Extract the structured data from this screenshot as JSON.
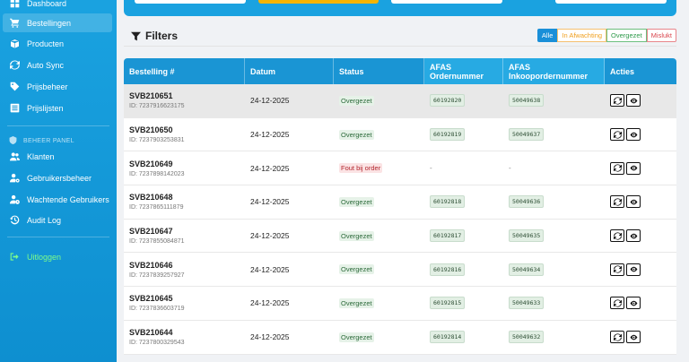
{
  "sidebar": {
    "items": [
      {
        "label": "Dashboard",
        "icon": "dashboard-icon"
      },
      {
        "label": "Bestellingen",
        "icon": "cart-icon",
        "active": true
      },
      {
        "label": "Producten",
        "icon": "box-icon"
      },
      {
        "label": "Auto Sync",
        "icon": "sync-icon"
      },
      {
        "label": "Prijsbeheer",
        "icon": "tag-icon"
      },
      {
        "label": "Prijslijsten",
        "icon": "list-icon"
      }
    ],
    "section_label": "BEHEER PANEL",
    "admin_items": [
      {
        "label": "Klanten",
        "icon": "users-icon"
      },
      {
        "label": "Gebruikersbeheer",
        "icon": "user-gear-icon"
      },
      {
        "label": "Wachtende Gebruikers",
        "icon": "user-clock-icon"
      },
      {
        "label": "Audit Log",
        "icon": "history-icon"
      }
    ],
    "logout_label": "Uitloggen"
  },
  "filters": {
    "title": "Filters",
    "buttons": [
      "Alle",
      "In Afwachting",
      "Overgezet",
      "Mislukt"
    ],
    "active": "Alle"
  },
  "table": {
    "headers": [
      "Bestelling #",
      "Datum",
      "Status",
      "AFAS Ordernummer",
      "AFAS Inkoopordernummer",
      "Acties"
    ],
    "rows": [
      {
        "order": "SVB210651",
        "id": "ID: 7237916623175",
        "date": "24-12-2025",
        "status": "Overgezet",
        "afas": "60192820",
        "inkoop": "50049638"
      },
      {
        "order": "SVB210650",
        "id": "ID: 7237903253831",
        "date": "24-12-2025",
        "status": "Overgezet",
        "afas": "60192819",
        "inkoop": "50049637"
      },
      {
        "order": "SVB210649",
        "id": "ID: 7237898142023",
        "date": "24-12-2025",
        "status": "Fout bij order",
        "afas": "-",
        "inkoop": "-"
      },
      {
        "order": "SVB210648",
        "id": "ID: 7237865111879",
        "date": "24-12-2025",
        "status": "Overgezet",
        "afas": "60192818",
        "inkoop": "50049636"
      },
      {
        "order": "SVB210647",
        "id": "ID: 7237855084871",
        "date": "24-12-2025",
        "status": "Overgezet",
        "afas": "60192817",
        "inkoop": "50049635"
      },
      {
        "order": "SVB210646",
        "id": "ID: 7237839257927",
        "date": "24-12-2025",
        "status": "Overgezet",
        "afas": "60192816",
        "inkoop": "50049634"
      },
      {
        "order": "SVB210645",
        "id": "ID: 7237836603719",
        "date": "24-12-2025",
        "status": "Overgezet",
        "afas": "60192815",
        "inkoop": "50049633"
      },
      {
        "order": "SVB210644",
        "id": "ID: 7237800329543",
        "date": "24-12-2025",
        "status": "Overgezet",
        "afas": "60192814",
        "inkoop": "50049632"
      }
    ]
  },
  "colors": {
    "sidebar_bg": "#1aa2e0",
    "header_bg": "#1a95d4",
    "success": "#2c6a3a",
    "danger": "#b3262e",
    "logout": "#7dfc8a"
  }
}
